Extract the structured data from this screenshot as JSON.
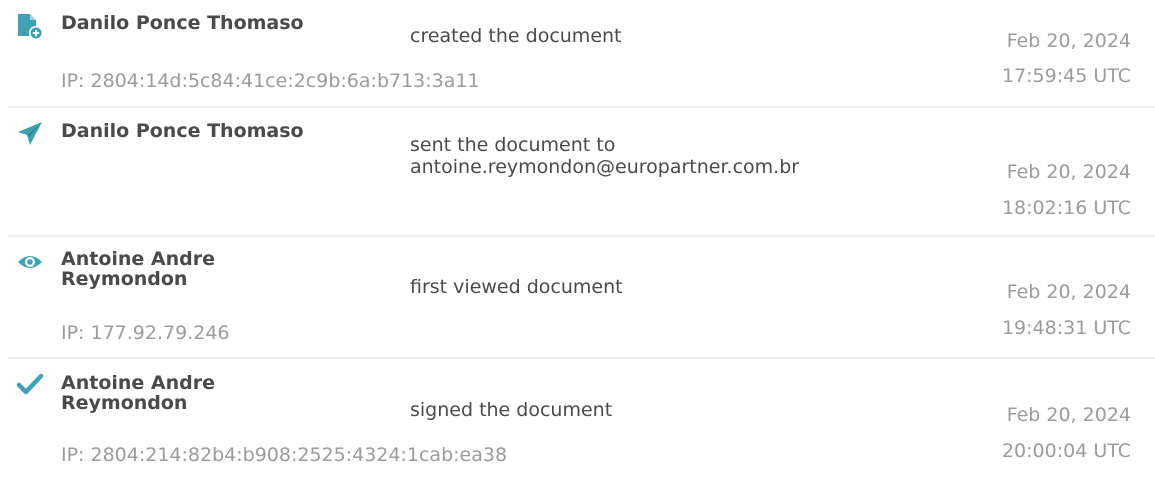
{
  "colors": {
    "icon_teal": "#3ea2b4",
    "name_text": "#4a4a4a",
    "meta_text": "#9b9b9b",
    "divider": "#ececec"
  },
  "events": [
    {
      "icon": "document-add-icon",
      "name": "Danilo Ponce Thomaso",
      "action": "created the document",
      "ip": "IP: 2804:14d:5c84:41ce:2c9b:6a:b713:3a11",
      "date": "Feb 20, 2024",
      "time": "17:59:45 UTC"
    },
    {
      "icon": "paper-plane-icon",
      "name": "Danilo Ponce Thomaso",
      "action_line1": "sent the document to",
      "action_line2": "antoine.reymondon@europartner.com.br",
      "date": "Feb 20, 2024",
      "time": "18:02:16 UTC"
    },
    {
      "icon": "eye-icon",
      "name": "Antoine Andre Reymondon",
      "action": "first viewed document",
      "ip": "IP: 177.92.79.246",
      "date": "Feb 20, 2024",
      "time": "19:48:31 UTC"
    },
    {
      "icon": "checkmark-icon",
      "name": "Antoine Andre Reymondon",
      "action": "signed the document",
      "ip": "IP: 2804:214:82b4:b908:2525:4324:1cab:ea38",
      "date": "Feb 20, 2024",
      "time": "20:00:04 UTC"
    }
  ]
}
